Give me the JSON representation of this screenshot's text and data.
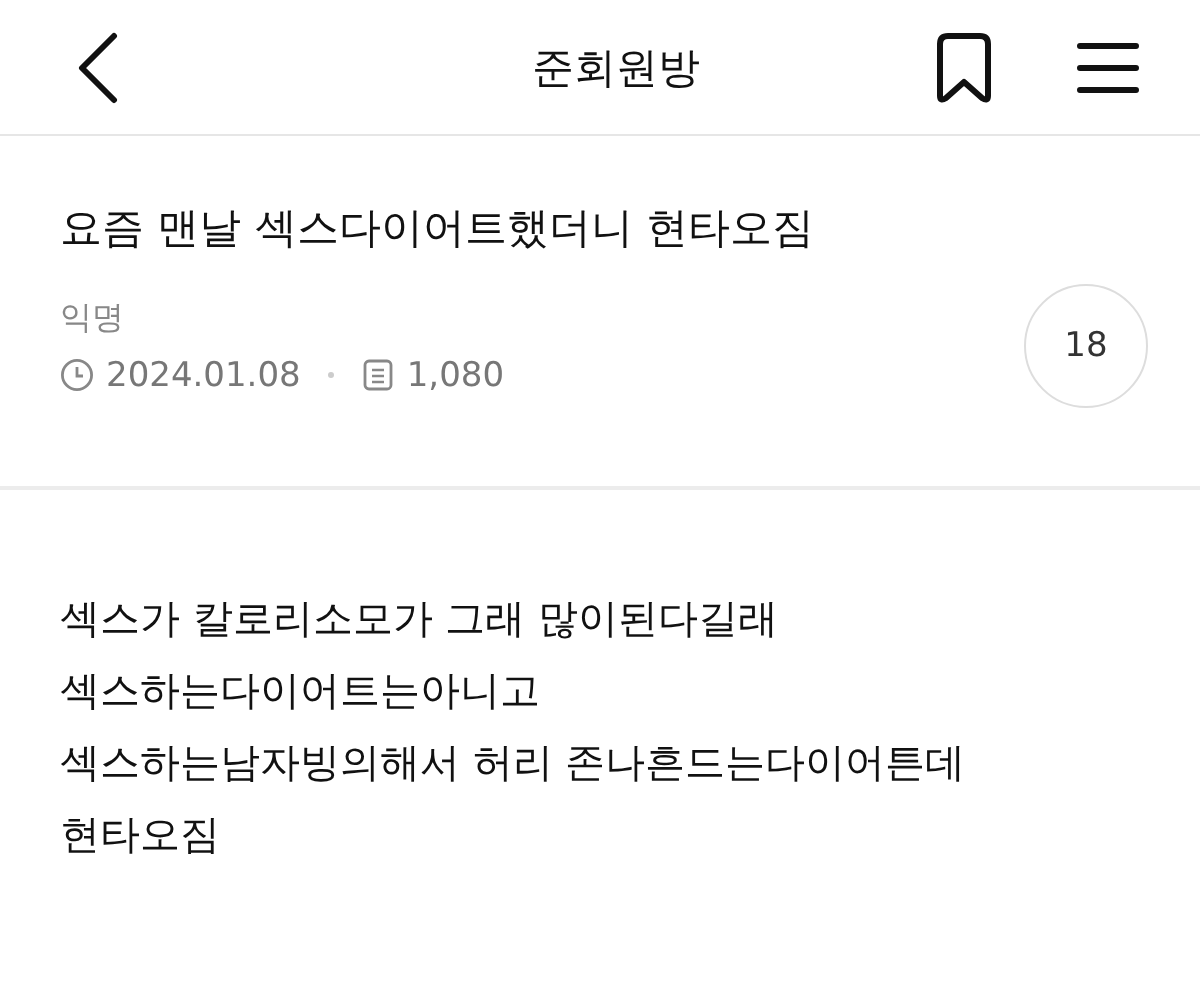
{
  "header": {
    "title": "준회원방"
  },
  "post": {
    "title": "요즘 맨날 섹스다이어트했더니 현타오짐",
    "author": "익명",
    "date": "2024.01.08",
    "views": "1,080",
    "comments": "18"
  },
  "body": [
    "섹스가 칼로리소모가 그래 많이된다길래 섹스하는다이어트는아니고",
    "섹스하는남자빙의해서 허리 존나흔드는다이어튼데 현타오짐"
  ]
}
